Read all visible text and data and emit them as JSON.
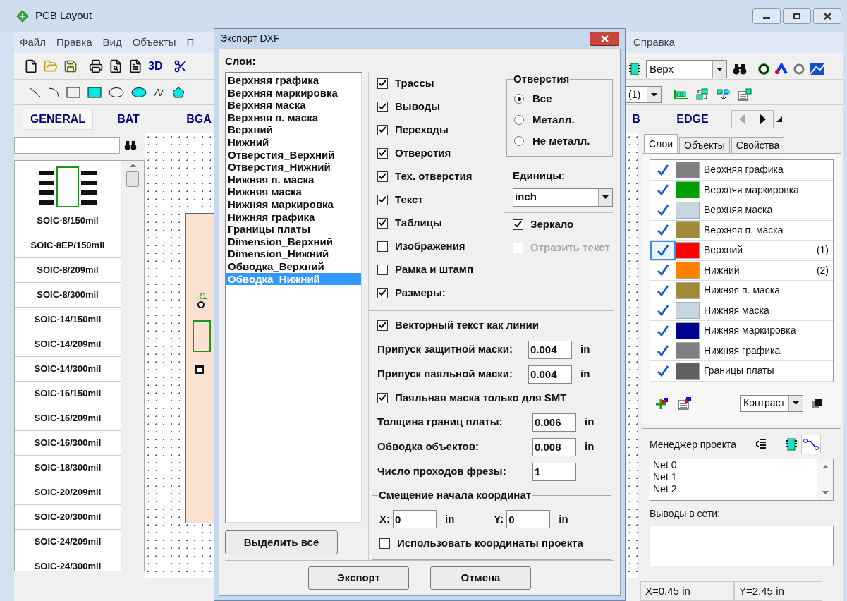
{
  "window": {
    "title": "PCB Layout"
  },
  "menu": [
    "Файл",
    "Правка",
    "Вид",
    "Объекты",
    "П",
    "Справка"
  ],
  "toolbar": {
    "mode_label": "3D",
    "layer_select": "Верх",
    "layer_number_select": "(1)"
  },
  "library_tabs": [
    {
      "label": "GENERAL",
      "selected": true
    },
    {
      "label": "BAT",
      "selected": false
    },
    {
      "label": "BGA",
      "selected": false
    },
    {
      "label": "B",
      "selected": false
    },
    {
      "label": "EDGE",
      "selected": false
    }
  ],
  "components": [
    {
      "name": "SOIC-8/150mil",
      "kind": "preview"
    },
    {
      "name": "SOIC-8EP/150mil",
      "kind": "plain"
    },
    {
      "name": "SOIC-8/209mil",
      "kind": "plain"
    },
    {
      "name": "SOIC-8/300mil",
      "kind": "plain"
    },
    {
      "name": "SOIC-14/150mil",
      "kind": "plain"
    },
    {
      "name": "SOIC-14/209mil",
      "kind": "plain"
    },
    {
      "name": "SOIC-14/300mil",
      "kind": "plain"
    },
    {
      "name": "SOIC-16/150mil",
      "kind": "plain"
    },
    {
      "name": "SOIC-16/209mil",
      "kind": "plain"
    },
    {
      "name": "SOIC-16/300mil",
      "kind": "plain"
    },
    {
      "name": "SOIC-18/300mil",
      "kind": "plain"
    },
    {
      "name": "SOIC-20/209mil",
      "kind": "plain"
    },
    {
      "name": "SOIC-20/300mil",
      "kind": "plain"
    },
    {
      "name": "SOIC-24/209mil",
      "kind": "plain"
    },
    {
      "name": "SOIC-24/300mil",
      "kind": "plain"
    }
  ],
  "canvas": {
    "designator": "R1"
  },
  "dialog": {
    "title": "Экспорт DXF",
    "layers_label": "Слои:",
    "layers": [
      {
        "name": "Верхняя графика",
        "selected": false
      },
      {
        "name": "Верхняя маркировка",
        "selected": false
      },
      {
        "name": "Верхняя маска",
        "selected": false
      },
      {
        "name": "Верхняя п. маска",
        "selected": false
      },
      {
        "name": "Верхний",
        "selected": false
      },
      {
        "name": "Нижний",
        "selected": false
      },
      {
        "name": "Отверстия_Верхний",
        "selected": false
      },
      {
        "name": "Отверстия_Нижний",
        "selected": false
      },
      {
        "name": "Нижняя п. маска",
        "selected": false
      },
      {
        "name": "Нижняя маска",
        "selected": false
      },
      {
        "name": "Нижняя маркировка",
        "selected": false
      },
      {
        "name": "Нижняя графика",
        "selected": false
      },
      {
        "name": "Границы платы",
        "selected": false
      },
      {
        "name": "Dimension_Верхний",
        "selected": false
      },
      {
        "name": "Dimension_Нижний",
        "selected": false
      },
      {
        "name": "Обводка_Верхний",
        "selected": false
      },
      {
        "name": "Обводка_Нижний",
        "selected": true
      }
    ],
    "select_all": "Выделить все",
    "objects": [
      {
        "label": "Трассы",
        "checked": true
      },
      {
        "label": "Выводы",
        "checked": true
      },
      {
        "label": "Переходы",
        "checked": true
      },
      {
        "label": "Отверстия",
        "checked": true
      },
      {
        "label": "Тех. отверстия",
        "checked": true
      },
      {
        "label": "Текст",
        "checked": true
      },
      {
        "label": "Таблицы",
        "checked": true
      },
      {
        "label": "Изображения",
        "checked": false
      },
      {
        "label": "Рамка и штамп",
        "checked": false
      },
      {
        "label": "Размеры:",
        "checked": true
      }
    ],
    "holes": {
      "title": "Отверстия",
      "options": [
        {
          "label": "Все",
          "selected": true
        },
        {
          "label": "Металл.",
          "selected": false
        },
        {
          "label": "Не металл.",
          "selected": false
        }
      ]
    },
    "units": {
      "label": "Единицы:",
      "value": "inch"
    },
    "mirror": {
      "label": "Зеркало",
      "checked": true,
      "disabled": false
    },
    "mirror_text": {
      "label": "Отразить текст",
      "checked": false,
      "disabled": true
    },
    "settings": [
      {
        "kind": "checkbox",
        "label": "Векторный текст как линии",
        "checked": true
      },
      {
        "kind": "field",
        "label": "Припуск защитной маски:",
        "value": "0.004",
        "unit": "in"
      },
      {
        "kind": "field",
        "label": "Припуск паяльной маски:",
        "value": "0.004",
        "unit": "in"
      },
      {
        "kind": "checkbox",
        "label": "Паяльная маска только для SMT",
        "checked": true
      },
      {
        "kind": "field",
        "label": "Толщина границ платы:",
        "value": "0.006",
        "unit": "in"
      },
      {
        "kind": "field",
        "label": "Обводка объектов:",
        "value": "0.008",
        "unit": "in"
      },
      {
        "kind": "field",
        "label": "Число проходов фрезы:",
        "value": "1"
      }
    ],
    "offset": {
      "title": "Смещение начала координат",
      "x": {
        "label": "X:",
        "value": "0",
        "unit": "in"
      },
      "y": {
        "label": "Y:",
        "value": "0",
        "unit": "in"
      },
      "use_project": {
        "label": "Использовать координаты проекта",
        "checked": false
      }
    },
    "buttons": [
      "Экспорт",
      "Отмена"
    ]
  },
  "right_panel": {
    "tabs": [
      {
        "label": "Слои",
        "selected": true
      },
      {
        "label": "Объекты",
        "selected": false
      },
      {
        "label": "Свойства",
        "selected": false
      }
    ],
    "layers": [
      {
        "name": "Верхняя графика",
        "color": "#808080",
        "visible": true,
        "selected": false
      },
      {
        "name": "Верхняя маркировка",
        "color": "#00a000",
        "visible": true,
        "selected": false
      },
      {
        "name": "Верхняя маска",
        "color": "#c8d4de",
        "visible": true,
        "selected": false
      },
      {
        "name": "Верхняя п. маска",
        "color": "#a08a3a",
        "visible": true,
        "selected": false
      },
      {
        "name": "Верхний",
        "color": "#ff0000",
        "visible": true,
        "selected": true,
        "number": "(1)"
      },
      {
        "name": "Нижний",
        "color": "#ff8000",
        "visible": true,
        "selected": false,
        "number": "(2)"
      },
      {
        "name": "Нижняя п. маска",
        "color": "#a08a3a",
        "visible": true,
        "selected": false
      },
      {
        "name": "Нижняя маска",
        "color": "#c8d4de",
        "visible": true,
        "selected": false
      },
      {
        "name": "Нижняя маркировка",
        "color": "#00008c",
        "visible": true,
        "selected": false
      },
      {
        "name": "Нижняя графика",
        "color": "#808080",
        "visible": true,
        "selected": false
      },
      {
        "name": "Границы платы",
        "color": "#606060",
        "visible": true,
        "selected": false
      }
    ],
    "view_select": "Контраст",
    "project_manager": {
      "title": "Менеджер проекта",
      "nets": [
        "Net 0",
        "Net 1",
        "Net 2"
      ],
      "pins_label": "Выводы в сети:"
    }
  },
  "status_bar": [
    "X=0.45 in",
    "Y=2.45 in"
  ]
}
